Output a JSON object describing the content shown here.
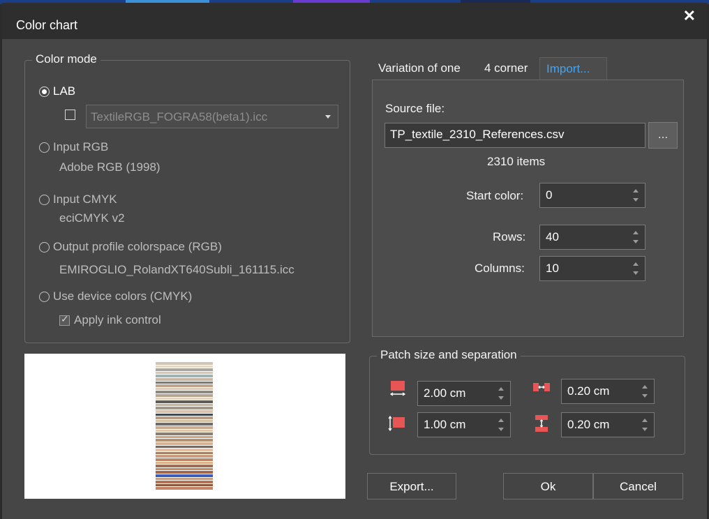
{
  "window": {
    "title": "Color chart"
  },
  "color_mode": {
    "legend": "Color mode",
    "lab": {
      "label": "LAB",
      "selected": true,
      "profile_value": "TextileRGB_FOGRA58(beta1).icc"
    },
    "input_rgb": {
      "label": "Input RGB",
      "profile": "Adobe RGB (1998)"
    },
    "input_cmyk": {
      "label": "Input CMYK",
      "profile": "eciCMYK v2"
    },
    "output_profile": {
      "label": "Output profile colorspace (RGB)",
      "profile": "EMIROGLIO_RolandXT640Subli_161115.icc"
    },
    "device_colors": {
      "label": "Use device colors (CMYK)",
      "ink_control_label": "Apply ink control",
      "ink_control_checked": true
    }
  },
  "tabs": [
    {
      "label": "Variation of one",
      "active": false
    },
    {
      "label": "4 corner",
      "active": false
    },
    {
      "label": "Import...",
      "active": true
    }
  ],
  "import": {
    "source_label": "Source file:",
    "source_value": "TP_textile_2310_References.csv",
    "browse_label": "...",
    "items_text": "2310 items",
    "start_color_label": "Start color:",
    "start_color_value": "0",
    "rows_label": "Rows:",
    "rows_value": "40",
    "columns_label": "Columns:",
    "columns_value": "10"
  },
  "patch": {
    "legend": "Patch size and separation",
    "width_value": "2.00 cm",
    "height_value": "1.00 cm",
    "h_separation_value": "0.20 cm",
    "v_separation_value": "0.20 cm"
  },
  "buttons": {
    "export": "Export...",
    "ok": "Ok",
    "cancel": "Cancel"
  },
  "colors": {
    "accent": "#39a7ff",
    "patch_icon": "#e85555",
    "background": "#464646"
  },
  "preview_colors": [
    "#cfc4b5",
    "#e6d8c4",
    "#a9a7a0",
    "#d8c6b2",
    "#9eb3b5",
    "#c9b89f",
    "#7f7b74",
    "#bfa38a",
    "#d9cbb8",
    "#8e8a83",
    "#b6a491",
    "#e3d2bd",
    "#5f5b57",
    "#c7b29a",
    "#a39887",
    "#d5c3ab",
    "#3f4a58",
    "#b99c82",
    "#d8c0a6",
    "#6e6b68",
    "#c9ad90",
    "#e0c6aa",
    "#8c7f72",
    "#caa588",
    "#b58f72",
    "#d3b496",
    "#7d6658",
    "#e2c1a3",
    "#a3806a",
    "#c99c7c",
    "#bb8766",
    "#dbb08e",
    "#9c6e55",
    "#c28a68",
    "#a46848",
    "#3b5cb8",
    "#d09a72",
    "#b37352",
    "#8a5643",
    "#c48462"
  ]
}
